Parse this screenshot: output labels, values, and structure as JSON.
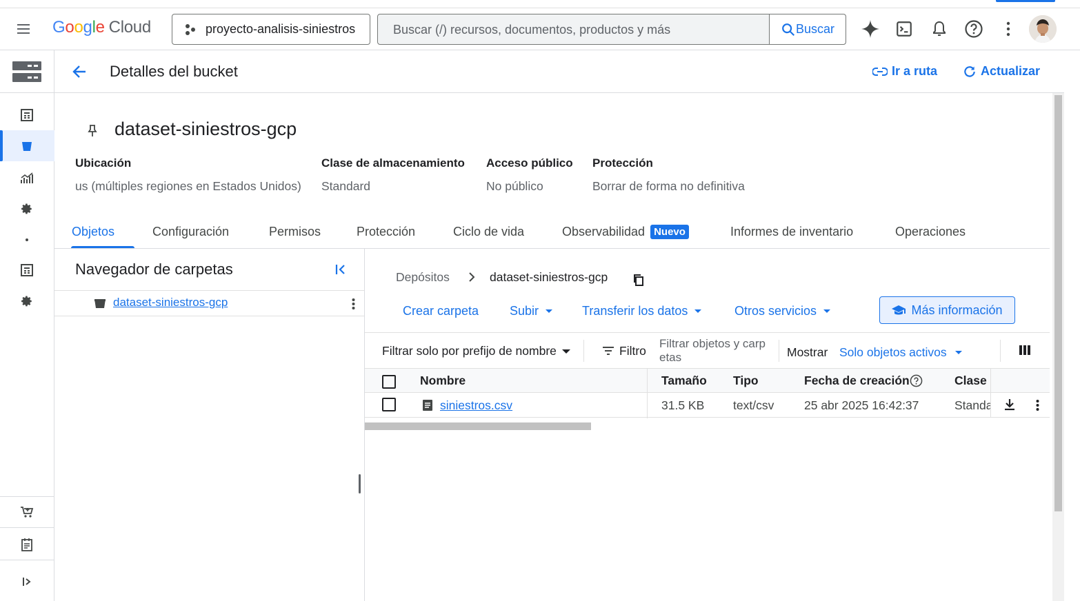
{
  "header": {
    "logo_google": "Google",
    "logo_cloud": "Cloud",
    "project": "proyecto-analisis-siniestros",
    "search_placeholder": "Buscar (/) recursos, documentos, productos y más",
    "search_button": "Buscar"
  },
  "page": {
    "title": "Detalles del bucket",
    "go_to_path": "Ir a ruta",
    "refresh": "Actualizar",
    "bucket_name": "dataset-siniestros-gcp"
  },
  "info": [
    {
      "label": "Ubicación",
      "value": "us (múltiples regiones en Estados Unidos)"
    },
    {
      "label": "Clase de almacenamiento",
      "value": "Standard"
    },
    {
      "label": "Acceso público",
      "value": "No público"
    },
    {
      "label": "Protección",
      "value": "Borrar de forma no definitiva"
    }
  ],
  "tabs": [
    {
      "label": "Objetos"
    },
    {
      "label": "Configuración"
    },
    {
      "label": "Permisos"
    },
    {
      "label": "Protección"
    },
    {
      "label": "Ciclo de vida"
    },
    {
      "label": "Observabilidad",
      "badge": "Nuevo"
    },
    {
      "label": "Informes de inventario"
    },
    {
      "label": "Operaciones"
    }
  ],
  "folder_browser": {
    "title": "Navegador de carpetas",
    "item": "dataset-siniestros-gcp"
  },
  "breadcrumb": {
    "root": "Depósitos",
    "current": "dataset-siniestros-gcp"
  },
  "actions": {
    "create_folder": "Crear carpeta",
    "upload": "Subir",
    "transfer": "Transferir los datos",
    "other": "Otros servicios",
    "more_info": "Más información"
  },
  "filter": {
    "prefix": "Filtrar solo por prefijo de nombre",
    "filter_label": "Filtro",
    "filter_placeholder_1": "Filtrar objetos y carp",
    "filter_placeholder_2": "etas",
    "show_label": "Mostrar",
    "show_value": "Solo objetos activos"
  },
  "table": {
    "columns": [
      "Nombre",
      "Tamaño",
      "Tipo",
      "Fecha de creación",
      "Clase"
    ],
    "rows": [
      {
        "name": "siniestros.csv",
        "size": "31.5 KB",
        "type": "text/csv",
        "created": "25 abr 2025 16:42:37",
        "class": "Standa"
      }
    ]
  },
  "colors": {
    "accent": "#1a73e8",
    "active_bg": "#e8f0fe"
  }
}
